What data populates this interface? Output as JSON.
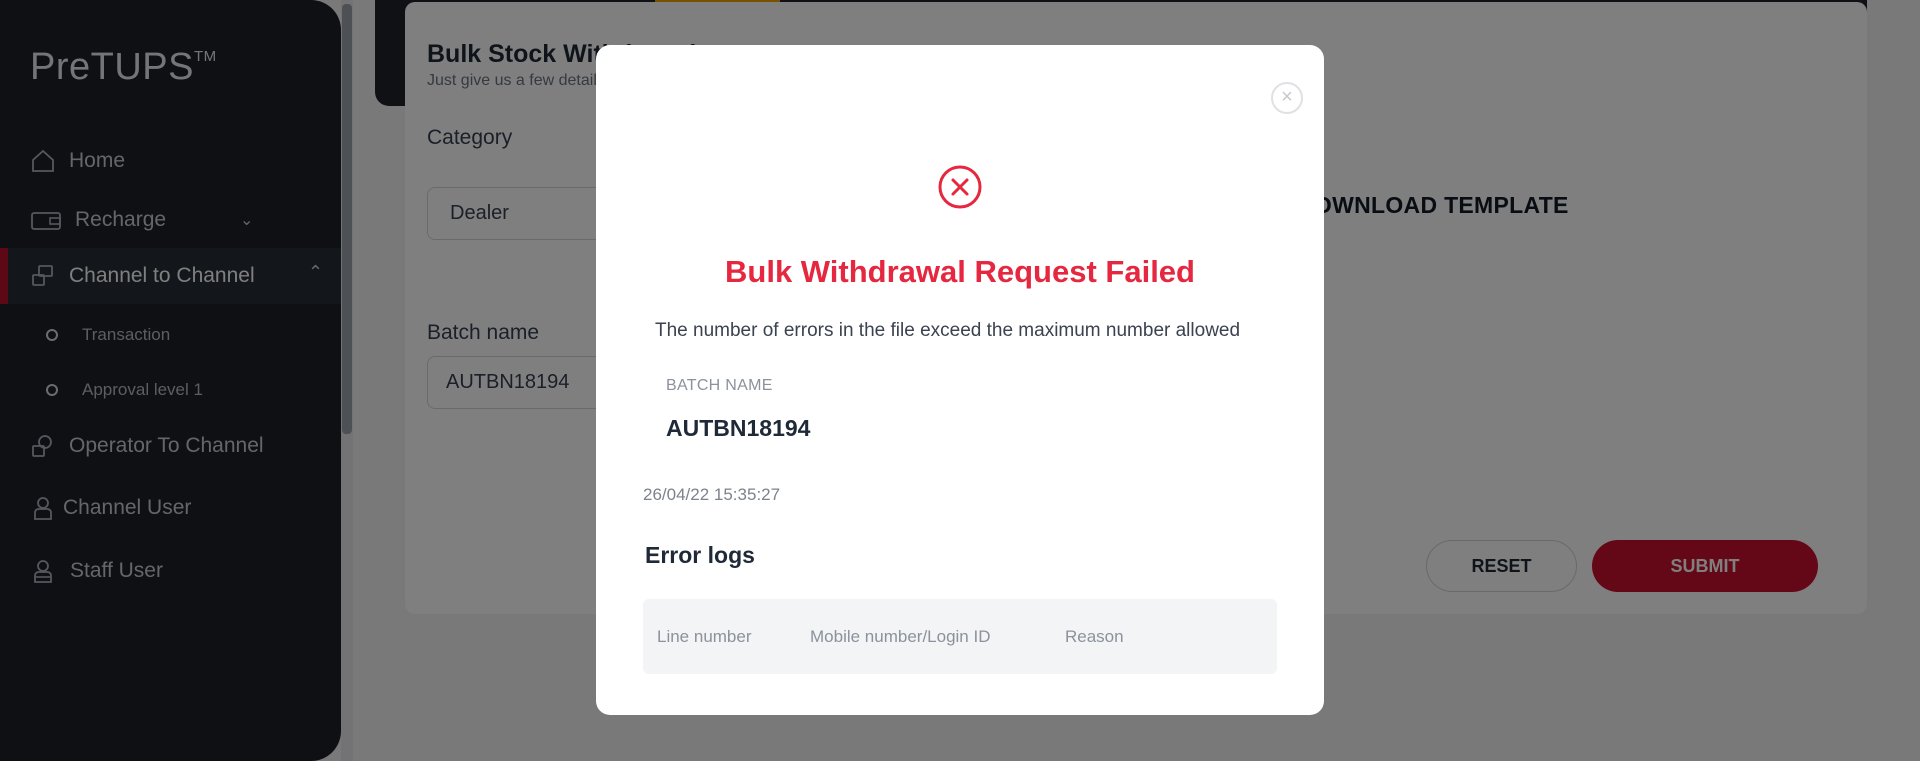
{
  "app": {
    "logo": "PreTUPS",
    "logo_tm": "TM"
  },
  "sidebar": {
    "items": [
      {
        "label": "Home",
        "icon": "home-icon"
      },
      {
        "label": "Recharge",
        "icon": "wallet-icon"
      },
      {
        "label": "Channel to Channel",
        "icon": "transfer-icon"
      },
      {
        "label": "Operator To Channel",
        "icon": "operator-transfer-icon"
      },
      {
        "label": "Channel User",
        "icon": "user-icon"
      },
      {
        "label": "Staff User",
        "icon": "staff-icon"
      }
    ],
    "subitems": [
      {
        "label": "Transaction"
      },
      {
        "label": "Approval level 1"
      }
    ],
    "active_color": "#b8102a"
  },
  "form": {
    "title": "Bulk Stock Withdrawal",
    "subtitle": "Just give us a few details",
    "category_label": "Category",
    "category_value": "Dealer",
    "batch_label": "Batch name",
    "batch_value": "AUTBN18194",
    "download_label": "DOWNLOAD TEMPLATE",
    "reset_label": "RESET",
    "submit_label": "SUBMIT",
    "submit_color": "#c8102e"
  },
  "modal": {
    "close_icon": "close-icon",
    "status_icon": "error-circle-icon",
    "title": "Bulk Withdrawal Request Failed",
    "message": "The number of errors in the file exceed the maximum number allowed",
    "batch_name_label": "BATCH NAME",
    "batch_name_value": "AUTBN18194",
    "timestamp": "26/04/22 15:35:27",
    "error_logs_title": "Error logs",
    "error_columns": [
      "Line number",
      "Mobile number/Login ID",
      "Reason"
    ],
    "title_color": "#e5273f"
  }
}
